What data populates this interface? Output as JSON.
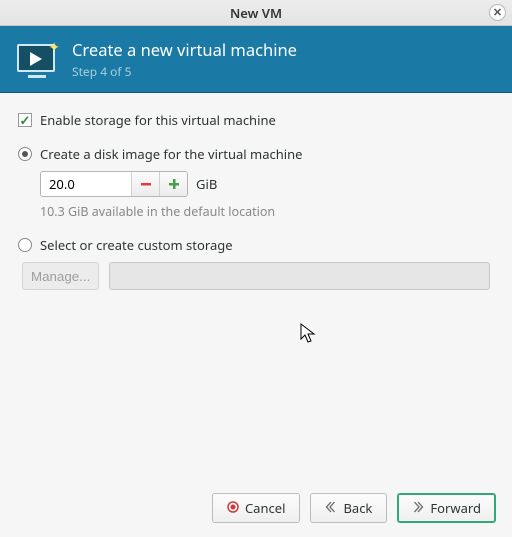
{
  "window": {
    "title": "New VM"
  },
  "banner": {
    "title": "Create a new virtual machine",
    "step": "Step 4 of 5"
  },
  "storage": {
    "enable_label": "Enable storage for this virtual machine",
    "create_label": "Create a disk image for the virtual machine",
    "size_value": "20.0",
    "size_unit": "GiB",
    "available_label": "10.3 GiB available in the default location",
    "custom_label": "Select or create custom storage",
    "manage_label": "Manage...",
    "custom_path": ""
  },
  "buttons": {
    "cancel": "Cancel",
    "back": "Back",
    "forward": "Forward"
  }
}
